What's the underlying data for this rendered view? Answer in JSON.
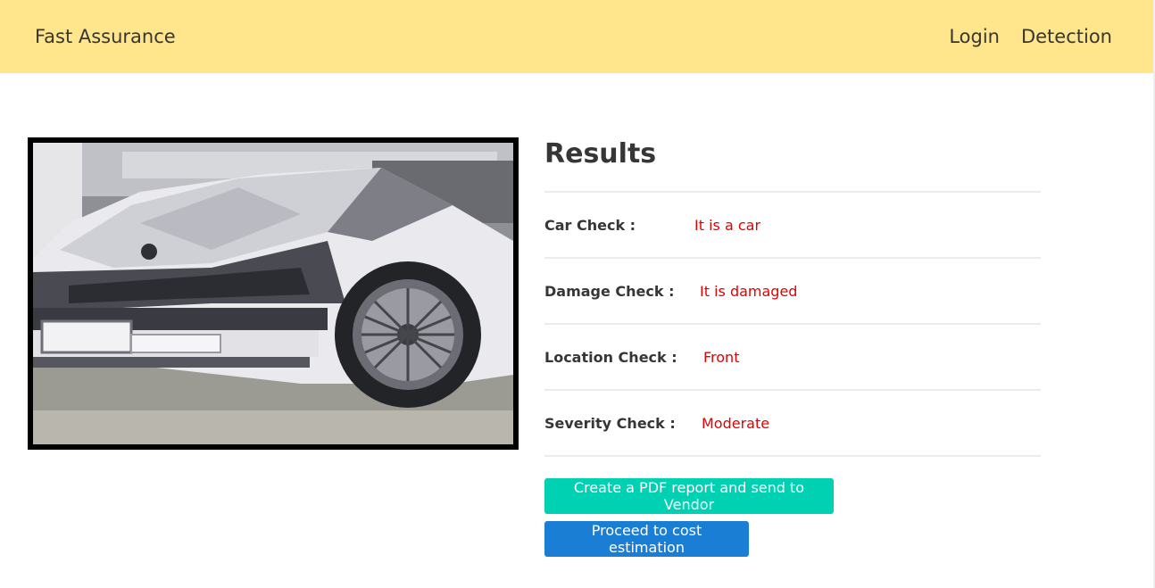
{
  "navbar": {
    "brand": "Fast Assurance",
    "links": [
      "Login",
      "Detection"
    ]
  },
  "results": {
    "title": "Results",
    "rows": [
      {
        "label": "Car Check :",
        "value": "It is a car"
      },
      {
        "label": "Damage Check :",
        "value": "It is damaged"
      },
      {
        "label": "Location Check :",
        "value": "Front"
      },
      {
        "label": "Severity Check :",
        "value": "Moderate"
      }
    ]
  },
  "buttons": {
    "pdf": "Create a PDF report and send to Vendor",
    "cost": "Proceed to cost estimation"
  },
  "colors": {
    "navbar": "#ffe68c",
    "value_text": "#e30000",
    "pdf_button": "#00d1b2",
    "cost_button": "#1a7fd4"
  },
  "image": {
    "subject": "damaged-white-car-photo"
  }
}
